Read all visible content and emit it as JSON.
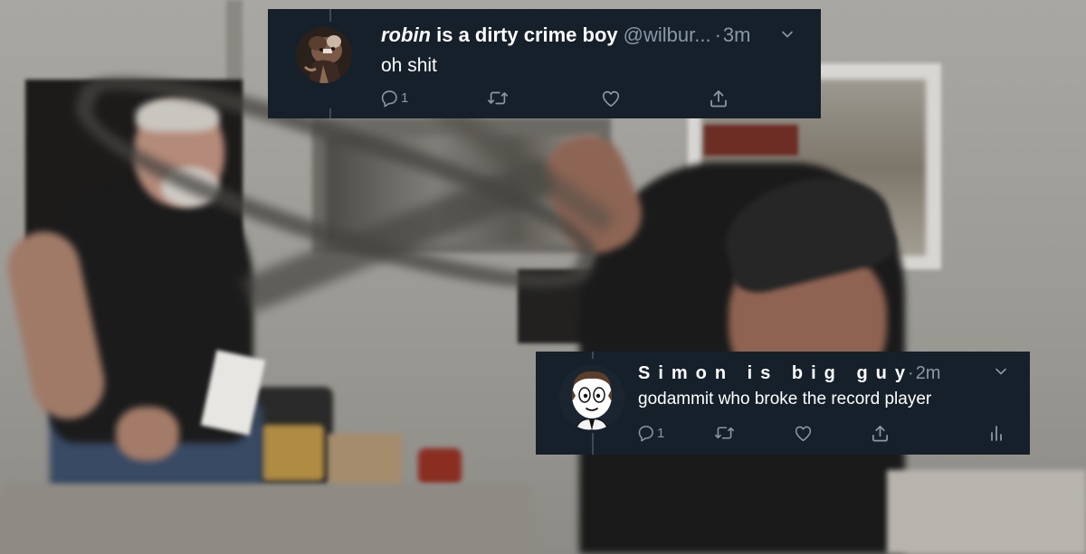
{
  "tweets": [
    {
      "display_name_italic": "robin",
      "display_name_rest": " is a dirty crime boy",
      "handle": "@wilbur...",
      "separator": "·",
      "time": "3m",
      "text": "oh shit",
      "reply_count": "1",
      "actions": [
        "reply-icon",
        "retweet-icon",
        "like-icon",
        "share-icon"
      ]
    },
    {
      "display_name": "Simon is big guy",
      "separator": "·",
      "time": "2m",
      "text": "godammit who broke the record player",
      "reply_count": "1",
      "actions": [
        "reply-icon",
        "retweet-icon",
        "like-icon",
        "share-icon",
        "analytics-icon"
      ]
    }
  ],
  "colors": {
    "card_background": "#16202b",
    "text_primary": "#ffffff",
    "text_secondary": "#8899a6",
    "thread_line": "#3c4954"
  }
}
